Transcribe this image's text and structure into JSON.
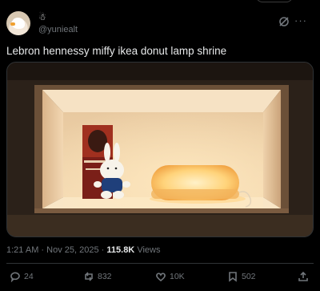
{
  "post": {
    "display_name_emoji": "☃",
    "handle": "@yuniealt",
    "text": "Lebron hennessy miffy ikea donut lamp shrine",
    "time": "1:21 AM",
    "separator": "·",
    "date": "Nov 25, 2025",
    "views_count": "115.8K",
    "views_label": "Views"
  },
  "header_icons": {
    "grok": "grok-icon",
    "more": "···"
  },
  "actions": {
    "replies": "24",
    "reposts": "832",
    "likes": "10K",
    "bookmarks": "502"
  },
  "colors": {
    "background": "#000000",
    "text": "#e7e9ea",
    "muted": "#71767b",
    "border": "#2f3336"
  }
}
